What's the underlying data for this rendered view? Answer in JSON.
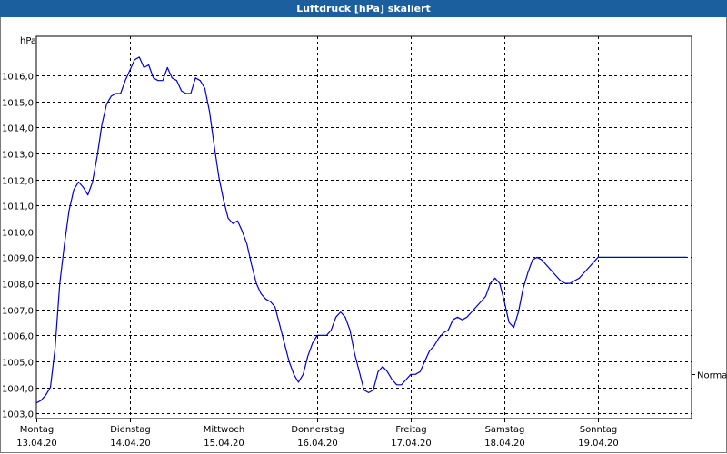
{
  "window": {
    "title": "Luftdruck [hPa] skaliert"
  },
  "chart_data": {
    "type": "line",
    "title": "Luftdruck [hPa] skaliert",
    "ylabel": "hPa",
    "xlabel": "",
    "ylim": [
      1002.8,
      1017.5
    ],
    "xlim": [
      0,
      7
    ],
    "grid": true,
    "y_ticks": [
      "1003,0",
      "1004,0",
      "1005,0",
      "1006,0",
      "1007,0",
      "1008,0",
      "1009,0",
      "1010,0",
      "1011,0",
      "1012,0",
      "1013,0",
      "1014,0",
      "1015,0",
      "1016,0"
    ],
    "y_tick_values": [
      1003,
      1004,
      1005,
      1006,
      1007,
      1008,
      1009,
      1010,
      1011,
      1012,
      1013,
      1014,
      1015,
      1016
    ],
    "x_ticks": [
      {
        "day": "Montag",
        "date": "13.04.20"
      },
      {
        "day": "Dienstag",
        "date": "14.04.20"
      },
      {
        "day": "Mittwoch",
        "date": "15.04.20"
      },
      {
        "day": "Donnerstag",
        "date": "16.04.20"
      },
      {
        "day": "Freitag",
        "date": "17.04.20"
      },
      {
        "day": "Samstag",
        "date": "18.04.20"
      },
      {
        "day": "Sonntag",
        "date": "19.04.20"
      }
    ],
    "reference_line": {
      "label": "Normal",
      "value": 1004.5
    },
    "series": [
      {
        "color": "#0000cc",
        "x": [
          0.0,
          0.05,
          0.1,
          0.15,
          0.2,
          0.25,
          0.3,
          0.35,
          0.4,
          0.45,
          0.5,
          0.55,
          0.6,
          0.65,
          0.7,
          0.75,
          0.8,
          0.85,
          0.9,
          0.95,
          1.0,
          1.05,
          1.1,
          1.15,
          1.2,
          1.25,
          1.3,
          1.35,
          1.4,
          1.45,
          1.5,
          1.55,
          1.6,
          1.65,
          1.7,
          1.75,
          1.8,
          1.85,
          1.9,
          1.95,
          2.0,
          2.05,
          2.1,
          2.15,
          2.2,
          2.25,
          2.3,
          2.35,
          2.4,
          2.45,
          2.5,
          2.55,
          2.6,
          2.65,
          2.7,
          2.75,
          2.8,
          2.85,
          2.9,
          2.95,
          3.0,
          3.05,
          3.1,
          3.15,
          3.2,
          3.25,
          3.3,
          3.35,
          3.4,
          3.45,
          3.5,
          3.55,
          3.6,
          3.65,
          3.7,
          3.75,
          3.8,
          3.85,
          3.9,
          3.95,
          4.0,
          4.05,
          4.1,
          4.15,
          4.2,
          4.25,
          4.3,
          4.35,
          4.4,
          4.45,
          4.5,
          4.55,
          4.6,
          4.65,
          4.7,
          4.75,
          4.8,
          4.85,
          4.9,
          4.95,
          5.0,
          5.05,
          5.1,
          5.15,
          5.2,
          5.25,
          5.3,
          5.35,
          5.4,
          5.45,
          5.5,
          5.55,
          5.6,
          5.65,
          5.7,
          5.75,
          5.8,
          5.85,
          5.9,
          5.95,
          6.0,
          6.05,
          6.1,
          6.15,
          6.2,
          6.25,
          6.3,
          6.35,
          6.4,
          6.45,
          6.5,
          6.55,
          6.6,
          6.65,
          6.7,
          6.75,
          6.8,
          6.85,
          6.9,
          6.95,
          7.0
        ],
        "values": [
          1003.4,
          1003.5,
          1003.7,
          1004.0,
          1005.5,
          1008.0,
          1009.5,
          1010.8,
          1011.6,
          1011.9,
          1011.7,
          1011.4,
          1011.9,
          1012.9,
          1014.1,
          1014.9,
          1015.2,
          1015.3,
          1015.3,
          1015.8,
          1016.2,
          1016.6,
          1016.7,
          1016.3,
          1016.4,
          1015.9,
          1015.8,
          1015.8,
          1016.3,
          1015.9,
          1015.8,
          1015.4,
          1015.3,
          1015.3,
          1015.9,
          1015.8,
          1015.5,
          1014.6,
          1013.3,
          1012.1,
          1011.2,
          1010.5,
          1010.3,
          1010.4,
          1010.0,
          1009.5,
          1008.7,
          1008.0,
          1007.6,
          1007.4,
          1007.3,
          1007.1,
          1006.4,
          1005.7,
          1005.0,
          1004.5,
          1004.2,
          1004.5,
          1005.2,
          1005.7,
          1006.0,
          1006.0,
          1006.0,
          1006.2,
          1006.7,
          1006.9,
          1006.7,
          1006.2,
          1005.3,
          1004.6,
          1003.9,
          1003.8,
          1003.9,
          1004.6,
          1004.8,
          1004.6,
          1004.3,
          1004.1,
          1004.1,
          1004.3,
          1004.5,
          1004.5,
          1004.6,
          1005.0,
          1005.4,
          1005.6,
          1005.9,
          1006.1,
          1006.2,
          1006.6,
          1006.7,
          1006.6,
          1006.7,
          1006.9,
          1007.1,
          1007.3,
          1007.5,
          1008.0,
          1008.2,
          1008.0,
          1007.3,
          1006.5,
          1006.3,
          1006.9,
          1007.8,
          1008.4,
          1008.9,
          1009.0,
          1008.9,
          1008.7,
          1008.5,
          1008.3,
          1008.1,
          1008.0,
          1008.0,
          1008.1,
          1008.2,
          1008.4,
          1008.6,
          1008.8,
          1009.0,
          1009.0,
          1009.0,
          1009.0,
          1009.0,
          1009.0,
          1009.0,
          1009.0,
          1009.0,
          1009.0,
          1009.0,
          1009.0,
          1009.0,
          1009.0,
          1009.0,
          1009.0,
          1009.0,
          1009.0,
          1009.0,
          1009.0,
          1009.0
        ]
      }
    ]
  }
}
